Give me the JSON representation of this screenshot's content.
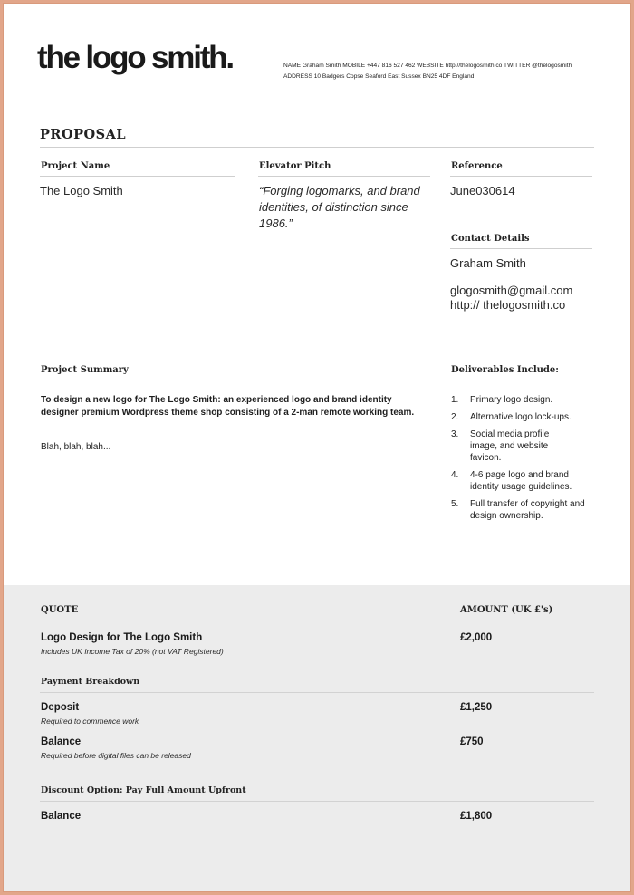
{
  "header": {
    "logo_text": "the logo smith.",
    "contact_line_1": "NAME Graham Smith   MOBILE +447 816 527 462   WEBSITE http://thelogosmith.co   TWITTER @thelogosmith",
    "contact_line_2": "ADDRESS 10 Badgers Copse  Seaford  East Sussex  BN25 4DF England"
  },
  "proposal": {
    "title": "PROPOSAL",
    "project_name_label": "Project Name",
    "project_name_value": "The Logo Smith",
    "elevator_pitch_label": "Elevator Pitch",
    "elevator_pitch_value": "“Forging logomarks, and brand identities, of distinction since 1986.”",
    "reference_label": "Reference",
    "reference_value": "June030614",
    "contact_label": "Contact Details",
    "contact_name": "Graham Smith",
    "contact_email": "glogosmith@gmail.com",
    "contact_website": "http:// thelogosmith.co"
  },
  "summary": {
    "label": "Project Summary",
    "paragraph": "To design a new logo for The Logo Smith: an experienced logo and brand identity designer premium Wordpress theme shop consisting of a 2-man remote working team.",
    "filler": "Blah, blah, blah..."
  },
  "deliverables": {
    "label": "Deliverables Include:",
    "items": [
      {
        "num": "1.",
        "text": "Primary logo design."
      },
      {
        "num": "2.",
        "text": "Alternative logo lock-ups."
      },
      {
        "num": "3.",
        "text": "Social media profile image, and website favicon."
      },
      {
        "num": "4.",
        "text": "4-6 page logo and brand identity usage guidelines."
      },
      {
        "num": "5.",
        "text": "Full transfer of copyright and design ownership."
      }
    ]
  },
  "quote": {
    "label": "QUOTE",
    "amount_label": "AMOUNT (UK £'s)",
    "main_item": {
      "title": "Logo Design for The Logo Smith",
      "note": "Includes UK Income Tax of 20% (not VAT Registered)",
      "amount": "£2,000"
    },
    "payment_breakdown_label": "Payment Breakdown",
    "deposit": {
      "title": "Deposit",
      "note": "Required to commence work",
      "amount": "£1,250"
    },
    "balance": {
      "title": "Balance",
      "note": "Required before digital files can be released",
      "amount": "£750"
    },
    "discount_label": "Discount Option: Pay Full Amount Upfront",
    "discount_balance": {
      "title": "Balance",
      "amount": "£1,800"
    }
  }
}
